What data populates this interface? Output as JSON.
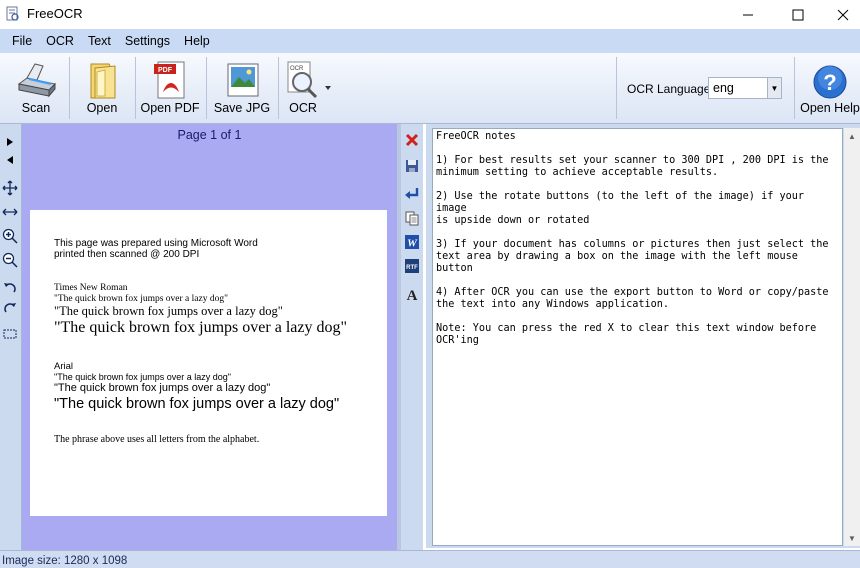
{
  "window": {
    "title": "FreeOCR",
    "icon": "freeocr-app-icon"
  },
  "menu": [
    "File",
    "OCR",
    "Text",
    "Settings",
    "Help"
  ],
  "toolbar": {
    "scan": "Scan",
    "open": "Open",
    "open_pdf": "Open PDF",
    "save_jpg": "Save JPG",
    "ocr": "OCR",
    "ocr_language_label": "OCR Language:",
    "ocr_language_value": "eng",
    "open_help": "Open Help"
  },
  "image_panel": {
    "page_label": "Page 1 of 1",
    "scan": {
      "line1": "This page was prepared using Microsoft Word",
      "line2": "printed then scanned @ 200 DPI",
      "tnr_heading": "Times New Roman",
      "tnr_small": "\"The quick brown fox jumps over a lazy dog\"",
      "tnr_medium": "\"The quick brown fox jumps over a lazy dog\"",
      "tnr_large": "\"The quick brown fox jumps over a lazy dog\"",
      "arial_heading": "Arial",
      "arial_small": "\"The quick brown fox jumps over a lazy dog\"",
      "arial_medium": "\"The quick brown fox  jumps over a lazy dog\"",
      "arial_large": "\"The quick brown fox jumps over a lazy dog\"",
      "footer": "The phrase above uses all letters from the alphabet."
    }
  },
  "text_panel": {
    "content": "FreeOCR notes\n\n1) For best results set your scanner to 300 DPI , 200 DPI is the\nminimum setting to achieve acceptable results.\n\n2) Use the rotate buttons (to the left of the image) if your image\nis upside down or rotated\n\n3) If your document has columns or pictures then just select the\ntext area by drawing a box on the image with the left mouse button\n\n4) After OCR you can use the export button to Word or copy/paste\nthe text into any Windows application.\n\nNote: You can press the red X to clear this text window before\nOCR'ing"
  },
  "status": {
    "image_size": "Image size:  1280 x  1098"
  },
  "colors": {
    "menu_bg": "#c9daf5",
    "image_bg": "#aaaaf2",
    "clear_red": "#d0211c",
    "word_blue": "#1f4fa8"
  }
}
